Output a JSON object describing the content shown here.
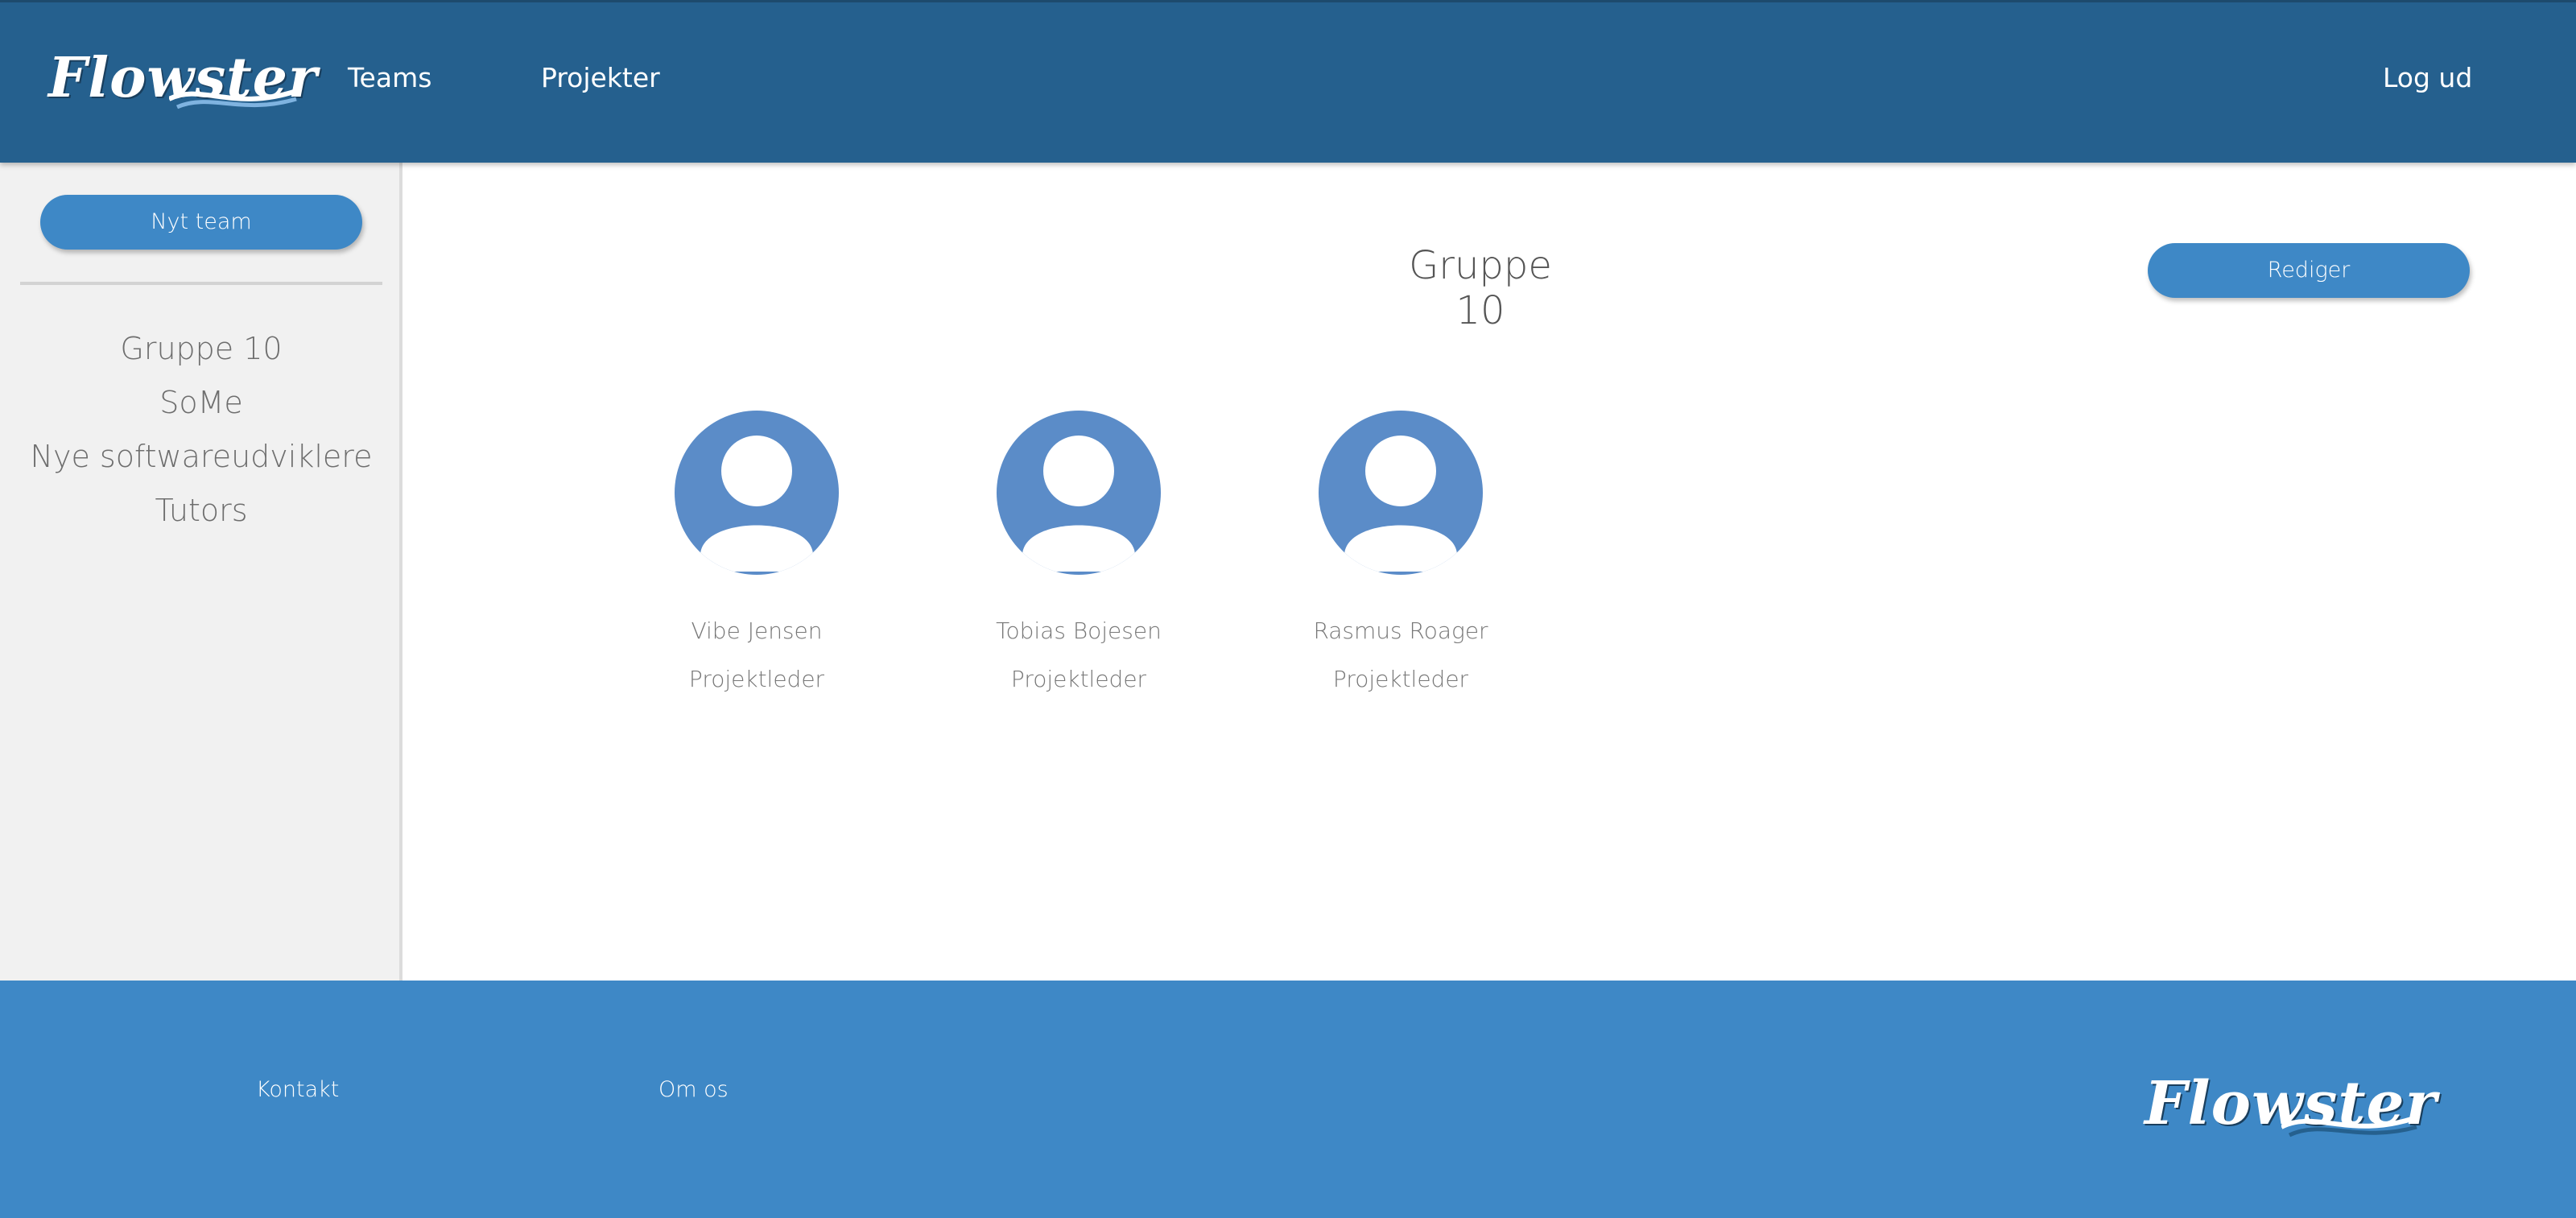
{
  "header": {
    "logo_text": "Flowster",
    "nav": [
      {
        "label": "Teams"
      },
      {
        "label": "Projekter"
      }
    ],
    "logout_label": "Log ud"
  },
  "sidebar": {
    "new_team_label": "Nyt team",
    "teams": [
      {
        "label": "Gruppe 10"
      },
      {
        "label": "SoMe"
      },
      {
        "label": "Nye softwareudviklere"
      },
      {
        "label": "Tutors"
      }
    ]
  },
  "main": {
    "title": "Gruppe 10",
    "edit_label": "Rediger",
    "members": [
      {
        "name": "Vibe Jensen",
        "role": "Projektleder"
      },
      {
        "name": "Tobias Bojesen",
        "role": "Projektleder"
      },
      {
        "name": "Rasmus Roager",
        "role": "Projektleder"
      }
    ]
  },
  "footer": {
    "links": [
      {
        "label": "Kontakt"
      },
      {
        "label": "Om os"
      }
    ],
    "logo_text": "Flowster"
  },
  "colors": {
    "header_bg": "#25608e",
    "accent": "#3e88c6",
    "avatar": "#5b8cc8",
    "sidebar_bg": "#f1f1f1"
  },
  "icons": {
    "avatar": "user-avatar-icon",
    "logo_wave": "wave-icon"
  }
}
